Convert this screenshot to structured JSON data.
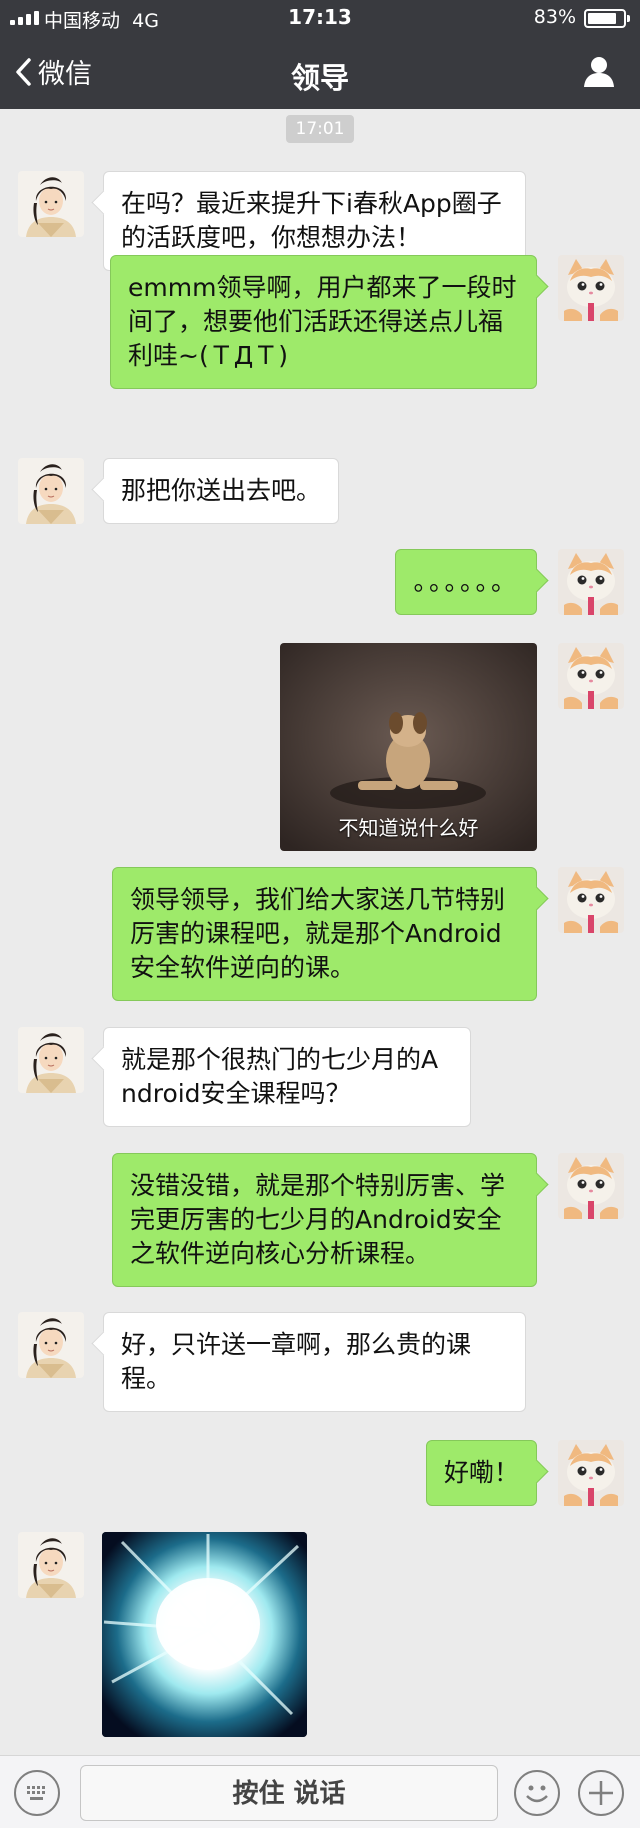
{
  "status_bar": {
    "carrier": "中国移动",
    "network": "4G",
    "time": "17:13",
    "battery_percent_label": "83%",
    "battery_level": 0.83
  },
  "nav": {
    "back_label": "微信",
    "title": "领导",
    "back_icon": "chevron-left-icon",
    "profile_icon": "person-icon"
  },
  "chat": {
    "timestamp": "17:01",
    "messages": [
      {
        "from": "other",
        "type": "text",
        "text": "在吗？最近来提升下i春秋App圈子的活跃度吧，你想想办法！"
      },
      {
        "from": "me",
        "type": "text",
        "text": "emmm领导啊，用户都来了一段时间了，想要他们活跃还得送点儿福利哇~(ＴДＴ)"
      },
      {
        "from": "other",
        "type": "text",
        "text": "那把你送出去吧。"
      },
      {
        "from": "me",
        "type": "text",
        "text": "。。。。。。"
      },
      {
        "from": "me",
        "type": "image",
        "caption": "不知道说什么好"
      },
      {
        "from": "me",
        "type": "text",
        "text": "领导领导，我们给大家送几节特别厉害的课程吧，就是那个Android安全软件逆向的课。"
      },
      {
        "from": "other",
        "type": "text",
        "text": "就是那个很热门的七少月的Android安全课程吗？"
      },
      {
        "from": "me",
        "type": "text",
        "text": "没错没错，就是那个特别厉害、学完更厉害的七少月的Android安全之软件逆向核心分析课程。"
      },
      {
        "from": "other",
        "type": "text",
        "text": "好，只许送一章啊，那么贵的课程。"
      },
      {
        "from": "me",
        "type": "text",
        "text": "好嘞！"
      },
      {
        "from": "other",
        "type": "image",
        "caption": ""
      }
    ]
  },
  "input_bar": {
    "hold_to_talk_label": "按住 说话",
    "keyboard_icon": "keyboard-icon",
    "emoji_icon": "emoji-icon",
    "plus_icon": "plus-icon"
  },
  "colors": {
    "nav_bg": "#393a3f",
    "chat_bg": "#ebebeb",
    "bubble_out": "#9eea6a",
    "bubble_in": "#ffffff"
  }
}
